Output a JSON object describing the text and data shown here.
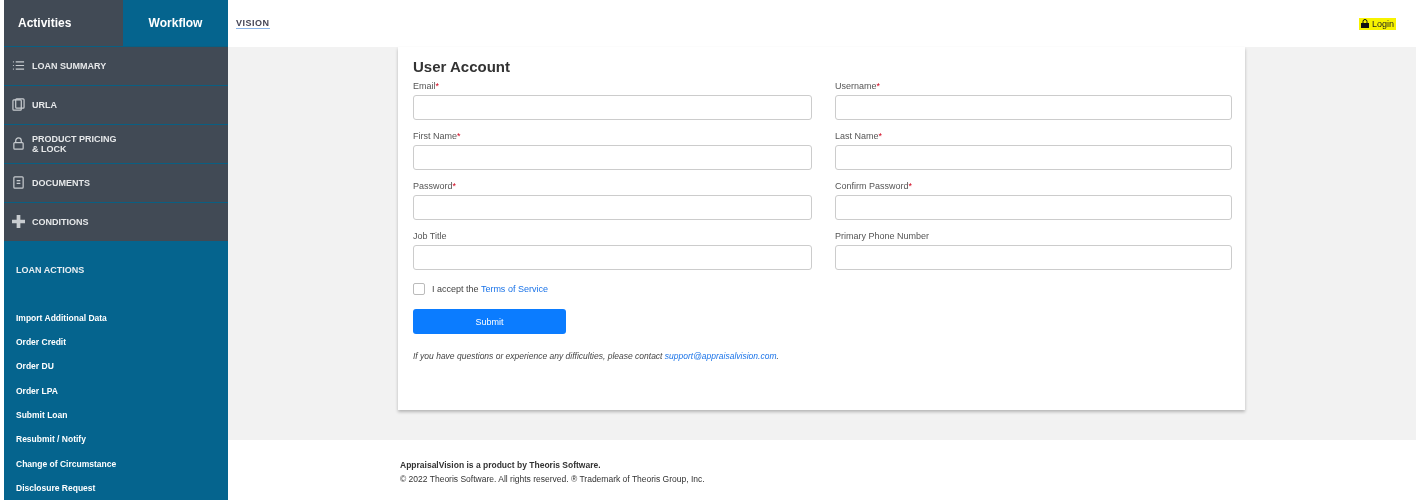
{
  "sidebar": {
    "tabs": [
      {
        "label": "Activities",
        "selected": false
      },
      {
        "label": "Workflow",
        "selected": true
      }
    ],
    "nav": [
      {
        "label": "LOAN SUMMARY"
      },
      {
        "label": "URLA"
      },
      {
        "label": "PRODUCT PRICING & LOCK"
      },
      {
        "label": "DOCUMENTS"
      },
      {
        "label": "CONDITIONS"
      }
    ],
    "actions_title": "LOAN ACTIONS",
    "actions": [
      "Import Additional Data",
      "Order Credit",
      "Order DU",
      "Order LPA",
      "Submit Loan",
      "Resubmit / Notify",
      "Change of Circumstance",
      "Disclosure Request"
    ]
  },
  "header": {
    "logo": "VISION",
    "login": "Login"
  },
  "form": {
    "title": "User Account",
    "fields": [
      {
        "label": "Email",
        "required_mark": "*"
      },
      {
        "label": "Username",
        "required_mark": "*"
      },
      {
        "label": "First Name",
        "required_mark": "*"
      },
      {
        "label": "Last Name",
        "required_mark": "*"
      },
      {
        "label": "Password",
        "required_mark": "*"
      },
      {
        "label": "Confirm Password",
        "required_mark": "*"
      },
      {
        "label": "Job Title"
      },
      {
        "label": "Primary Phone Number"
      }
    ],
    "terms": {
      "checked": false,
      "text": "I accept the",
      "link": "Terms of Service"
    },
    "submit": "Submit",
    "note": {
      "text": "If you have questions or experience any difficulties, please contact",
      "link": "support@appraisalvision.com",
      "end": "."
    }
  },
  "footer": {
    "title": "AppraisalVision is a product by Theoris Software.",
    "copyright": "© 2022 Theoris Software. All rights reserved. ® Trademark of Theoris Group, Inc."
  }
}
